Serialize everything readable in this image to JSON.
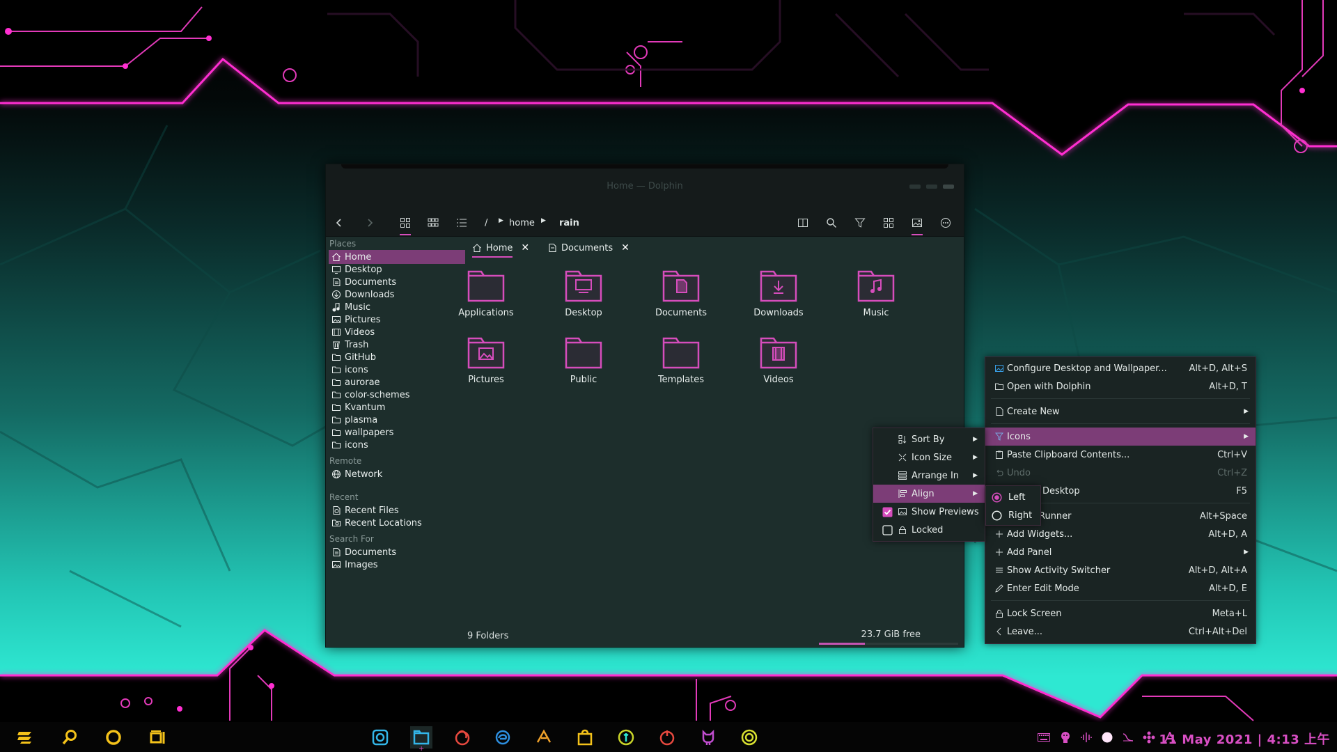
{
  "window": {
    "title": "Home — Dolphin"
  },
  "toolbar": {
    "breadcrumb": [
      "/",
      "home",
      "rain"
    ]
  },
  "sidebar": {
    "places_heading": "Places",
    "places": [
      {
        "label": "Home",
        "icon": "home-icon",
        "selected": true
      },
      {
        "label": "Desktop",
        "icon": "desktop-icon"
      },
      {
        "label": "Documents",
        "icon": "documents-icon"
      },
      {
        "label": "Downloads",
        "icon": "downloads-icon"
      },
      {
        "label": "Music",
        "icon": "music-icon"
      },
      {
        "label": "Pictures",
        "icon": "pictures-icon"
      },
      {
        "label": "Videos",
        "icon": "videos-icon"
      },
      {
        "label": "Trash",
        "icon": "trash-icon"
      },
      {
        "label": "GitHub",
        "icon": "folder-icon"
      },
      {
        "label": "icons",
        "icon": "folder-icon"
      },
      {
        "label": "aurorae",
        "icon": "folder-icon"
      },
      {
        "label": "color-schemes",
        "icon": "folder-icon"
      },
      {
        "label": "Kvantum",
        "icon": "folder-icon"
      },
      {
        "label": "plasma",
        "icon": "folder-icon"
      },
      {
        "label": "wallpapers",
        "icon": "folder-icon"
      },
      {
        "label": "icons",
        "icon": "folder-icon"
      }
    ],
    "remote_heading": "Remote",
    "remote": [
      {
        "label": "Network",
        "icon": "network-icon"
      }
    ],
    "recent_heading": "Recent",
    "recent": [
      {
        "label": "Recent Files",
        "icon": "recent-files-icon"
      },
      {
        "label": "Recent Locations",
        "icon": "recent-locations-icon"
      }
    ],
    "search_heading": "Search For",
    "search": [
      {
        "label": "Documents",
        "icon": "documents-icon"
      },
      {
        "label": "Images",
        "icon": "images-icon"
      }
    ]
  },
  "tabs": [
    {
      "label": "Home",
      "icon": "home-icon",
      "active": true
    },
    {
      "label": "Documents",
      "icon": "documents-icon",
      "active": false
    }
  ],
  "folders": [
    {
      "label": "Applications",
      "icon": "blank"
    },
    {
      "label": "Desktop",
      "icon": "desktop"
    },
    {
      "label": "Documents",
      "icon": "document"
    },
    {
      "label": "Downloads",
      "icon": "download"
    },
    {
      "label": "Music",
      "icon": "music"
    },
    {
      "label": "Pictures",
      "icon": "picture"
    },
    {
      "label": "Public",
      "icon": "blank"
    },
    {
      "label": "Templates",
      "icon": "blank"
    },
    {
      "label": "Videos",
      "icon": "video"
    }
  ],
  "status": {
    "left": "9 Folders",
    "free": "23.7 GiB free",
    "used_fraction": 0.33
  },
  "desktop_menu": {
    "items": [
      {
        "label": "Configure Desktop and Wallpaper...",
        "shortcut": "Alt+D, Alt+S",
        "icon": "configure-icon"
      },
      {
        "label": "Open with Dolphin",
        "shortcut": "Alt+D, T",
        "icon": "folder-open-icon"
      },
      {
        "label": "Create New",
        "icon": "create-new-icon",
        "submenu": true
      },
      {
        "label": "Icons",
        "icon": "icons-icon",
        "submenu": true,
        "highlighted": true
      },
      {
        "label": "Paste Clipboard Contents...",
        "shortcut": "Ctrl+V",
        "icon": "paste-icon"
      },
      {
        "label": "Undo",
        "shortcut": "Ctrl+Z",
        "icon": "undo-icon",
        "disabled": true
      },
      {
        "label": "Desktop",
        "shortcut": "F5",
        "icon": "refresh-icon"
      },
      {
        "label": "Runner",
        "shortcut": "Alt+Space",
        "icon": "runner-icon"
      },
      {
        "label": "Add Widgets...",
        "shortcut": "Alt+D, A",
        "icon": "plus-icon"
      },
      {
        "label": "Add Panel",
        "icon": "plus-icon",
        "submenu": true
      },
      {
        "label": "Show Activity Switcher",
        "shortcut": "Alt+D, Alt+A",
        "icon": "activity-icon"
      },
      {
        "label": "Enter Edit Mode",
        "shortcut": "Alt+D, E",
        "icon": "edit-icon"
      },
      {
        "label": "Lock Screen",
        "shortcut": "Meta+L",
        "icon": "lock-icon"
      },
      {
        "label": "Leave...",
        "shortcut": "Ctrl+Alt+Del",
        "icon": "leave-icon"
      }
    ]
  },
  "icons_menu": {
    "items": [
      {
        "label": "Sort By",
        "icon": "sort-icon",
        "submenu": true
      },
      {
        "label": "Icon Size",
        "icon": "icon-size-icon",
        "submenu": true
      },
      {
        "label": "Arrange In",
        "icon": "arrange-icon",
        "submenu": true
      },
      {
        "label": "Align",
        "icon": "align-icon",
        "submenu": true,
        "highlighted": true
      },
      {
        "label": "Show Previews",
        "icon": "previews-icon",
        "checked": true
      },
      {
        "label": "Locked",
        "icon": "lock-icon",
        "checked": false
      }
    ]
  },
  "align_menu": {
    "items": [
      {
        "label": "Left",
        "selected": true
      },
      {
        "label": "Right",
        "selected": false
      }
    ]
  },
  "panel": {
    "launchers": [
      "app-menu-icon",
      "search-icon",
      "overview-icon",
      "task-switcher-icon"
    ],
    "tasks": [
      "screenshot-icon",
      "dolphin-icon",
      "firefox-icon",
      "edge-icon",
      "krita-icon",
      "store-icon",
      "terminal-icon",
      "media-icon",
      "github-icon",
      "settings-icon"
    ],
    "tray": [
      "keyboard-icon",
      "mascot-icon",
      "audio-icon",
      "night-icon",
      "network-icon",
      "bluetooth-icon",
      "updates-icon"
    ],
    "clock": "11 May 2021 | 4:13 上午"
  },
  "colors": {
    "accent": "#d64dbc",
    "highlight": "#7c3d77",
    "neon_pink": "#ff2fd1",
    "teal": "#2ee8d2"
  }
}
